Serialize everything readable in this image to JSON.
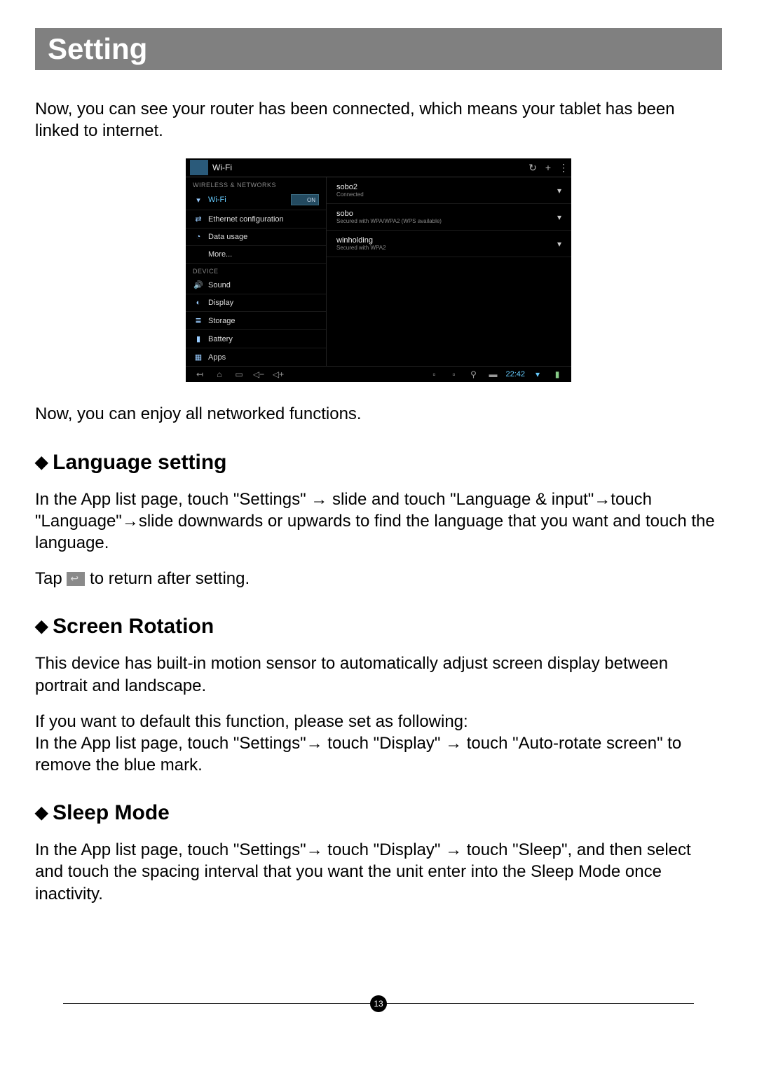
{
  "banner": "Setting",
  "intro": "Now, you can see your router has been connected, which means your tablet has been linked to internet.",
  "screenshot": {
    "title": "Wi-Fi",
    "header_icons": [
      "sync-icon",
      "add-icon",
      "menu-icon"
    ],
    "header_glyphs": [
      "↻",
      "+",
      "⋮"
    ],
    "left": {
      "cat1": "WIRELESS & NETWORKS",
      "wifi": "Wi-Fi",
      "wifi_switch": "ON",
      "ethernet": "Ethernet configuration",
      "data": "Data usage",
      "more": "More...",
      "cat2": "DEVICE",
      "sound": "Sound",
      "display": "Display",
      "storage": "Storage",
      "battery": "Battery",
      "apps": "Apps"
    },
    "networks": [
      {
        "name": "sobo2",
        "sub": "Connected"
      },
      {
        "name": "sobo",
        "sub": "Secured with WPA/WPA2 (WPS available)"
      },
      {
        "name": "winholding",
        "sub": "Secured with WPA2"
      }
    ],
    "signal_glyph": "▾",
    "nav": {
      "back": "↤",
      "home": "⌂",
      "recent": "▭",
      "voldown": "◁−",
      "volup": "◁+",
      "clock": "22:42"
    }
  },
  "after_shot": "Now, you can enjoy all networked functions.",
  "lang": {
    "heading": "Language setting",
    "text": "In the App list page, touch \"Settings\" → slide and touch \"Language & input\"→touch \"Language\"→slide downwards or upwards to find the language that you want and touch the language.",
    "tap1": "Tap ",
    "tap2": " to return after setting."
  },
  "rotation": {
    "heading": "Screen Rotation",
    "p1": "This device has built-in motion sensor to automatically adjust screen display between portrait and landscape.",
    "p2": "If you want to default this function, please set as following:\nIn the App list page, touch \"Settings\"→ touch \"Display\" → touch \"Auto-rotate screen\" to remove the blue mark."
  },
  "sleep": {
    "heading": "Sleep Mode",
    "text": "In the App list page, touch \"Settings\"→ touch \"Display\" → touch \"Sleep\", and then select and touch the spacing interval that you want the unit enter into the Sleep Mode once inactivity."
  },
  "page_number": "13"
}
